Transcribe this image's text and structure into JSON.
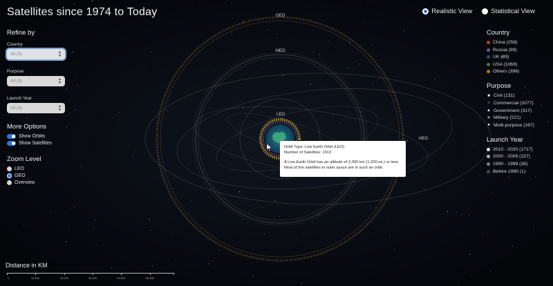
{
  "title": "Satellites since 1974 to Today",
  "view_toggle": {
    "realistic": "Realistic View",
    "statistical": "Statistical View",
    "selected": "realistic"
  },
  "refine": {
    "title": "Refine by",
    "country": {
      "label": "Country",
      "value": "All (5)"
    },
    "purpose": {
      "label": "Purpose",
      "value": "All (5)"
    },
    "launch_year": {
      "label": "Launch Year",
      "value": "All (4)"
    }
  },
  "more_options": {
    "title": "More Options",
    "show_orbits": "Show Orbits",
    "show_satellites": "Show Satellites"
  },
  "zoom": {
    "title": "Zoom Level",
    "options": [
      "LEO",
      "GEO",
      "Overview"
    ],
    "selected": "GEO"
  },
  "legend": {
    "country": {
      "title": "Country",
      "items": [
        {
          "label": "China (258)",
          "color": "#c0392b"
        },
        {
          "label": "Russia (99)",
          "color": "#6b5b95"
        },
        {
          "label": "UK (89)",
          "color": "#2e4a7a"
        },
        {
          "label": "USA (1069)",
          "color": "#4f7a2a"
        },
        {
          "label": "Others (398)",
          "color": "#b07a22"
        }
      ]
    },
    "purpose": {
      "title": "Purpose",
      "items": [
        {
          "label": "Civil (131)",
          "icon": "square-icon"
        },
        {
          "label": "Commercial (1077)",
          "icon": "ring-icon"
        },
        {
          "label": "Government (317)",
          "icon": "triangle-icon"
        },
        {
          "label": "Military (221)",
          "icon": "cross-icon"
        },
        {
          "label": "Multi-purpose (167)",
          "icon": "dot-icon"
        }
      ]
    },
    "launch_year": {
      "title": "Launch Year",
      "items": [
        {
          "label": "2010 - 2020 (1717)",
          "color": "#e6e6e6"
        },
        {
          "label": "2000 - 2009 (157)",
          "color": "#b5b5b5"
        },
        {
          "label": "1990 - 1999 (38)",
          "color": "#7d7d7d"
        },
        {
          "label": "Before 1990 (1)",
          "color": "#4a4a4a"
        }
      ]
    }
  },
  "orbits": {
    "geo": "GEO",
    "meo": "MEO",
    "leo": "LEO",
    "heo": "HEO"
  },
  "tooltip": {
    "line1": "Orbit Type: Low Earth Orbit (LEO)",
    "line2": "Number of Satellites: 1913",
    "line3": "A Low Earth Orbit has an altitude of 2,000 km (1,200 mi.) or less.",
    "line4": "Most of the satellites in outer space are in such an orbit."
  },
  "distance": {
    "title": "Distance in KM",
    "ticks": [
      "0",
      "10,000",
      "20,000",
      "30,000",
      "40,000",
      "50,000"
    ]
  }
}
